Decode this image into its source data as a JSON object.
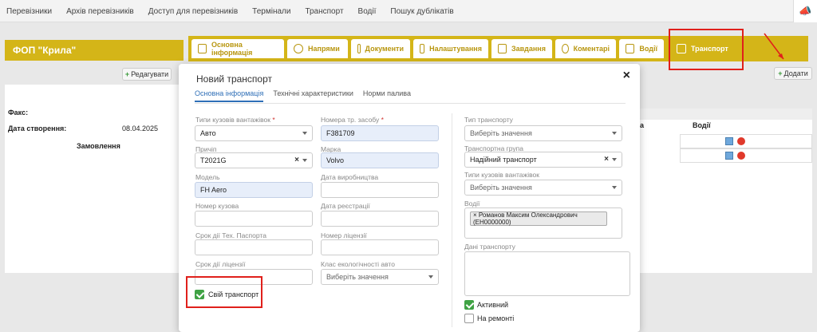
{
  "topnav": {
    "items": [
      "Перевізники",
      "Архів перевізників",
      "Доступ для перевізників",
      "Термінали",
      "Транспорт",
      "Водії",
      "Пошук дублікатів"
    ]
  },
  "company": {
    "name": "ФОП \"Крила\""
  },
  "tabs": [
    "Основна інформація",
    "Напрями",
    "Документи",
    "Налаштування",
    "Завдання",
    "Коментарі",
    "Водії",
    "Транспорт"
  ],
  "buttons": {
    "edit": "Редагувати",
    "add": "Додати"
  },
  "left_panel": {
    "fax_label": "Факс:",
    "created_label": "Дата створення:",
    "created_value": "08.04.2025",
    "orders_label": "Замовлення"
  },
  "right_panel": {
    "col1": "а",
    "col2": "Водії"
  },
  "modal": {
    "title": "Новий транспорт",
    "tabs": [
      "Основна інформація",
      "Технічні характеристики",
      "Норми палива"
    ],
    "body_types_label": "Типи кузовів вантажівок",
    "body_types_value": "Авто",
    "plate_label": "Номера тр. засобу",
    "plate_value": "F381709",
    "trailer_label": "Причіп",
    "trailer_value": "T2021G",
    "brand_label": "Марка",
    "brand_value": "Volvo",
    "model_label": "Модель",
    "model_value": "FH Aero",
    "prod_date_label": "Дата виробництва",
    "body_no_label": "Номер кузова",
    "reg_date_label": "Дата реєстрації",
    "tech_passport_label": "Срок дії Тех. Паспорта",
    "license_no_label": "Номер ліцензії",
    "license_term_label": "Срок дії ліцензії",
    "eco_class_label": "Клас екологічності авто",
    "eco_class_placeholder": "Виберіть значення",
    "own_transport_label": "Свій транспорт",
    "transport_type_label": "Тип транспорту",
    "transport_type_placeholder": "Виберіть значення",
    "transport_group_label": "Транспортна група",
    "transport_group_value": "Надійний транспорт",
    "body_types2_label": "Типи кузовів вантажівок",
    "body_types2_placeholder": "Виберіть значення",
    "drivers_label": "Водії",
    "driver_chip": "× Романов Максим Олександрович (ЕН0000000)",
    "transport_data_label": "Дані транспорту",
    "active_label": "Активний",
    "repair_label": "На ремонті"
  }
}
